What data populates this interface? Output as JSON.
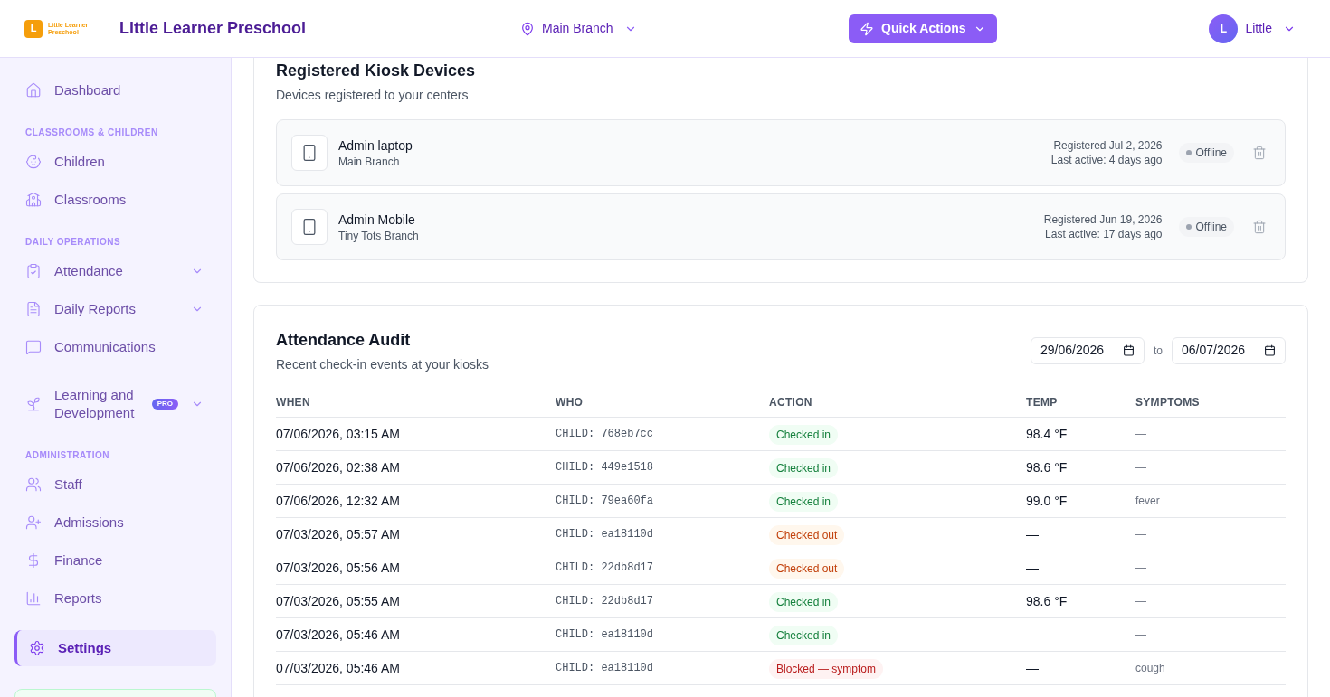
{
  "header": {
    "logo": {
      "letter": "L",
      "lines": [
        "Little Learner",
        "Preschool"
      ]
    },
    "title": "Little Learner Preschool",
    "branch": "Main Branch",
    "quick_actions": "Quick Actions",
    "user": {
      "initial": "L",
      "name": "Little"
    }
  },
  "sidebar": {
    "sections": [
      {
        "items": [
          {
            "label": "Dashboard",
            "kind": "link",
            "selected": false
          }
        ]
      },
      {
        "heading": "CLASSROOMS & CHILDREN",
        "items": [
          {
            "label": "Children",
            "kind": "link",
            "selected": false
          },
          {
            "label": "Classrooms",
            "kind": "link",
            "selected": false
          }
        ]
      },
      {
        "heading": "DAILY OPERATIONS",
        "items": [
          {
            "label": "Attendance",
            "kind": "group",
            "expanded": false,
            "selected": false
          },
          {
            "label": "Daily Reports",
            "kind": "group",
            "expanded": false,
            "selected": false
          },
          {
            "label": "Communications",
            "kind": "link",
            "selected": false
          },
          {
            "label": "Learning and Development",
            "kind": "group",
            "expanded": false,
            "badge": "PRO",
            "selected": false
          }
        ]
      },
      {
        "heading": "ADMINISTRATION",
        "items": [
          {
            "label": "Staff",
            "kind": "link",
            "selected": false
          },
          {
            "label": "Admissions",
            "kind": "link",
            "selected": false
          },
          {
            "label": "Finance",
            "kind": "link",
            "selected": false
          },
          {
            "label": "Reports",
            "kind": "link",
            "selected": false
          }
        ]
      },
      {
        "items": [
          {
            "label": "Settings",
            "kind": "link",
            "selected": true
          }
        ]
      }
    ]
  },
  "devices_card": {
    "title": "Registered Kiosk Devices",
    "subtitle": "Devices registered to your centers",
    "devices": [
      {
        "name": "Admin laptop",
        "branch": "Main Branch",
        "registered": "Registered Jul 2, 2026",
        "last_active": "Last active: 4 days ago",
        "status": "Offline",
        "online": false
      },
      {
        "name": "Admin Mobile",
        "branch": "Tiny Tots Branch",
        "registered": "Registered Jun 19, 2026",
        "last_active": "Last active: 17 days ago",
        "status": "Offline",
        "online": false
      }
    ]
  },
  "audit_card": {
    "title": "Attendance Audit",
    "subtitle": "Recent check-in events at your kiosks",
    "date_from": "29/06/2026",
    "date_separator": "to",
    "date_to": "06/07/2026",
    "table": {
      "columns": [
        "WHEN",
        "WHO",
        "ACTION",
        "TEMP",
        "SYMPTOMS"
      ],
      "rows": [
        {
          "when": "07/06/2026, 03:15 AM",
          "who": "CHILD: 768eb7cc",
          "action": {
            "label": "Checked in",
            "kind": "checked_in"
          },
          "temp": "98.4 °F",
          "symptoms": "—"
        },
        {
          "when": "07/06/2026, 02:38 AM",
          "who": "CHILD: 449e1518",
          "action": {
            "label": "Checked in",
            "kind": "checked_in"
          },
          "temp": "98.6 °F",
          "symptoms": "—"
        },
        {
          "when": "07/06/2026, 12:32 AM",
          "who": "CHILD: 79ea60fa",
          "action": {
            "label": "Checked in",
            "kind": "checked_in"
          },
          "temp": "99.0 °F",
          "symptoms": "fever"
        },
        {
          "when": "07/03/2026, 05:57 AM",
          "who": "CHILD: ea18110d",
          "action": {
            "label": "Checked out",
            "kind": "checked_out"
          },
          "temp": "—",
          "symptoms": "—"
        },
        {
          "when": "07/03/2026, 05:56 AM",
          "who": "CHILD: 22db8d17",
          "action": {
            "label": "Checked out",
            "kind": "checked_out"
          },
          "temp": "—",
          "symptoms": "—"
        },
        {
          "when": "07/03/2026, 05:55 AM",
          "who": "CHILD: 22db8d17",
          "action": {
            "label": "Checked in",
            "kind": "checked_in"
          },
          "temp": "98.6 °F",
          "symptoms": "—"
        },
        {
          "when": "07/03/2026, 05:46 AM",
          "who": "CHILD: ea18110d",
          "action": {
            "label": "Checked in",
            "kind": "checked_in"
          },
          "temp": "—",
          "symptoms": "—"
        },
        {
          "when": "07/03/2026, 05:46 AM",
          "who": "CHILD: ea18110d",
          "action": {
            "label": "Blocked — symptom",
            "kind": "blocked"
          },
          "temp": "—",
          "symptoms": "cough"
        }
      ]
    }
  }
}
